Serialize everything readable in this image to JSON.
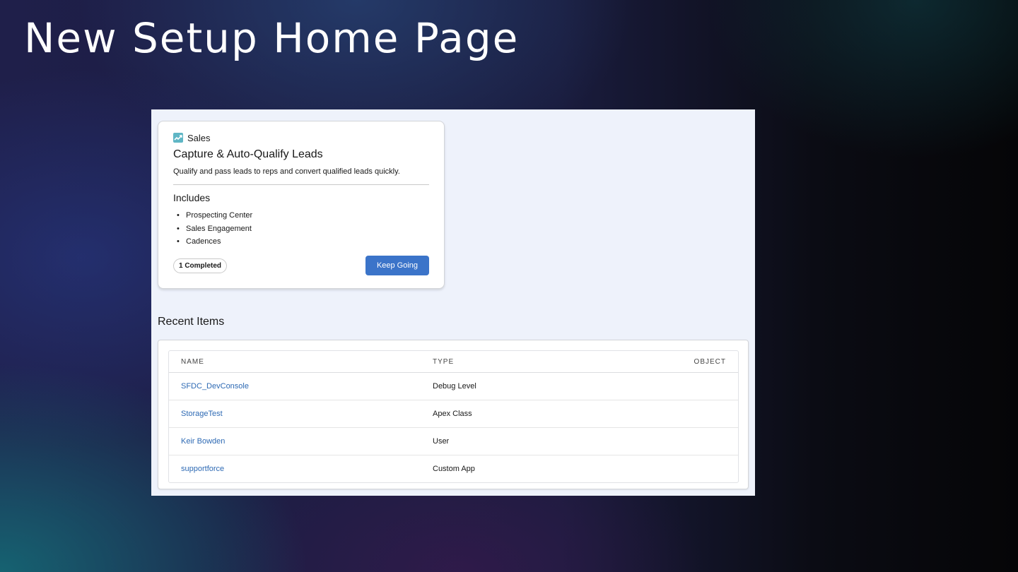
{
  "slide": {
    "title": "New Setup Home Page"
  },
  "card": {
    "category": "Sales",
    "category_icon": "chart-trend-icon",
    "title": "Capture & Auto-Qualify Leads",
    "description": "Qualify and pass leads to reps and convert qualified leads quickly.",
    "includes_label": "Includes",
    "includes": [
      "Prospecting Center",
      "Sales Engagement",
      "Cadences"
    ],
    "badge": "1 Completed",
    "button": "Keep Going"
  },
  "recent": {
    "title": "Recent Items",
    "columns": [
      "NAME",
      "TYPE",
      "OBJECT"
    ],
    "rows": [
      {
        "name": "SFDC_DevConsole",
        "type": "Debug Level",
        "object": ""
      },
      {
        "name": "StorageTest",
        "type": "Apex Class",
        "object": ""
      },
      {
        "name": "Keir Bowden",
        "type": "User",
        "object": ""
      },
      {
        "name": "supportforce",
        "type": "Custom App",
        "object": ""
      }
    ]
  },
  "colors": {
    "accent": "#3b74c9",
    "link": "#2e6ab4",
    "panel_bg": "#eef2fb"
  }
}
